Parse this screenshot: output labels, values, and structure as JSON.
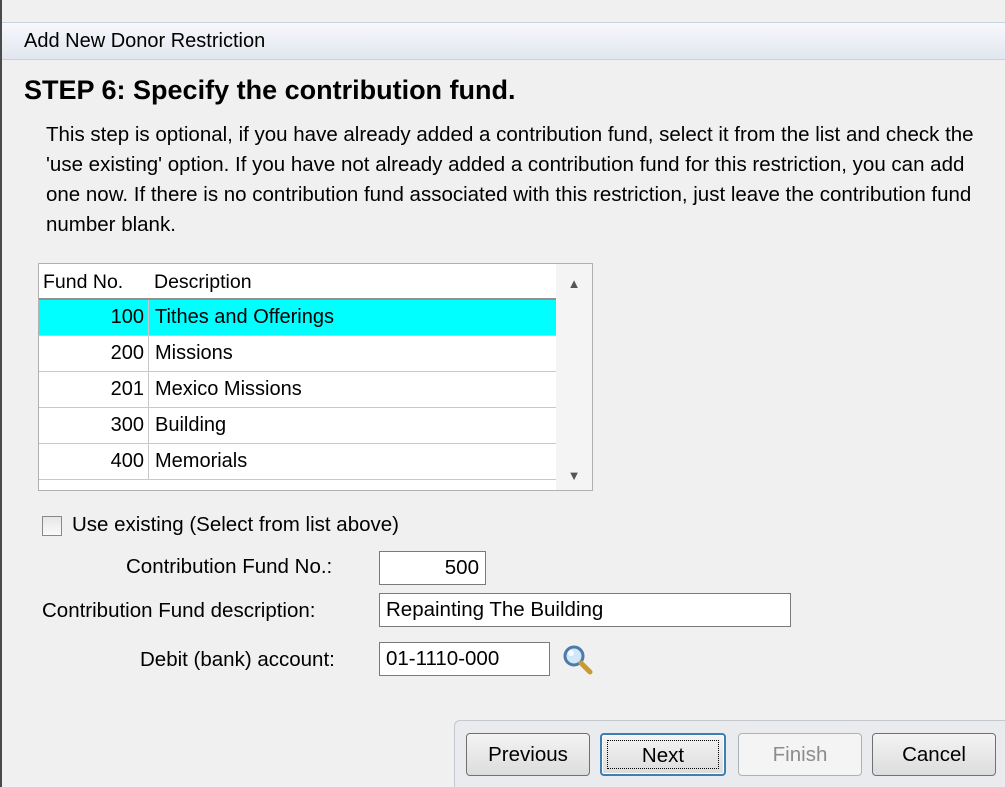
{
  "window": {
    "title": "Add New Donor Restriction"
  },
  "step": {
    "title": "STEP 6: Specify the contribution fund.",
    "instructions": "This step is optional, if you have already added a contribution fund, select it from the list and check the 'use existing' option. If you have not already added a contribution fund for this restriction, you can add one now. If there is no contribution fund associated with this restriction, just leave the contribution fund number blank."
  },
  "fund_table": {
    "columns": [
      "Fund No.",
      "Description"
    ],
    "rows": [
      {
        "no": "100",
        "description": "Tithes and Offerings",
        "selected": true
      },
      {
        "no": "200",
        "description": "Missions",
        "selected": false
      },
      {
        "no": "201",
        "description": "Mexico Missions",
        "selected": false
      },
      {
        "no": "300",
        "description": "Building",
        "selected": false
      },
      {
        "no": "400",
        "description": "Memorials",
        "selected": false
      }
    ]
  },
  "form": {
    "use_existing_label": "Use existing (Select from list above)",
    "use_existing_checked": false,
    "fund_no_label": "Contribution Fund No.:",
    "fund_no_value": "500",
    "fund_desc_label": "Contribution Fund description:",
    "fund_desc_value": "Repainting The Building",
    "debit_label": "Debit (bank) account:",
    "debit_value": "01-1110-000",
    "lookup_icon": "magnifier-icon"
  },
  "buttons": {
    "previous": "Previous",
    "next": "Next",
    "finish": "Finish",
    "cancel": "Cancel"
  },
  "colors": {
    "selected_row": "#00ffff",
    "default_button_border": "#3c7fb1"
  }
}
